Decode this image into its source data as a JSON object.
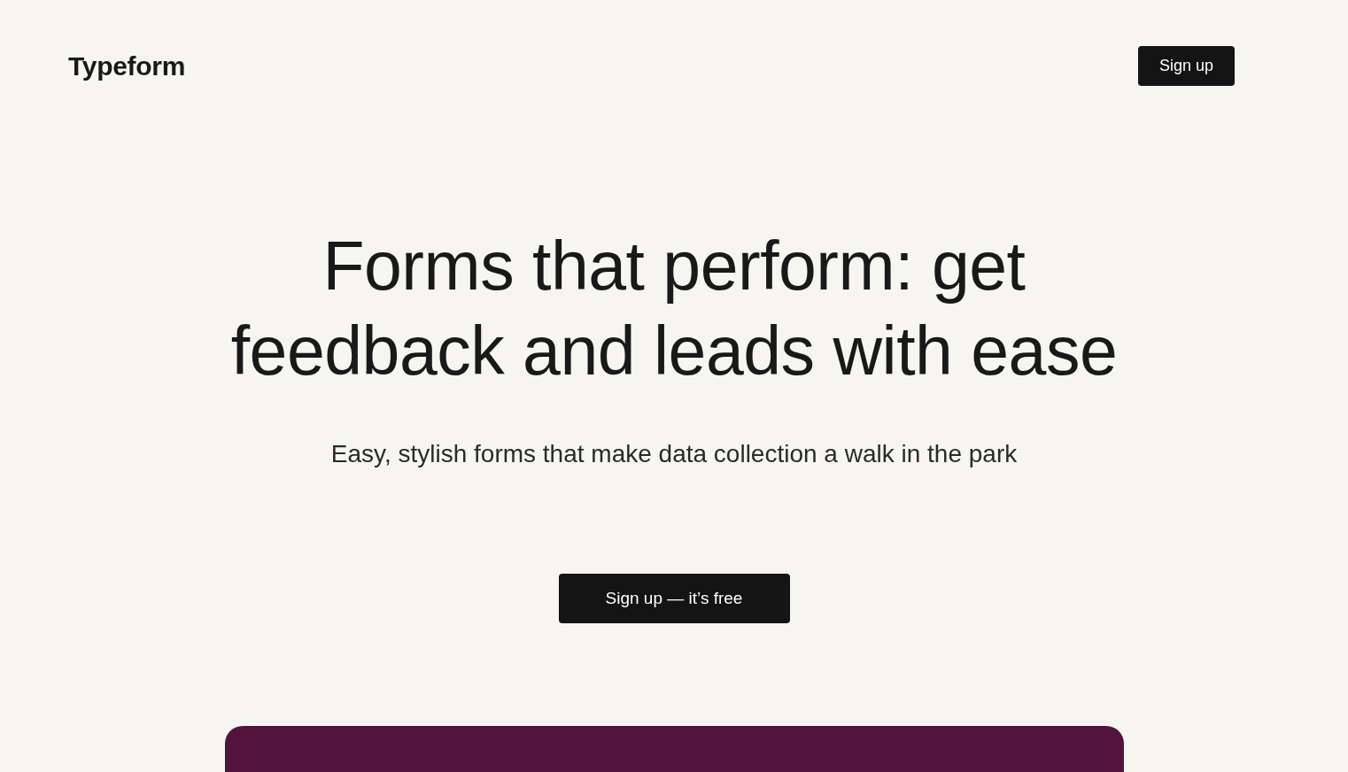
{
  "header": {
    "logo": "Typeform",
    "signup_button": "Sign up"
  },
  "hero": {
    "heading": "Forms that perform: get feedback and leads with ease",
    "subheading": "Easy, stylish forms that make data collection a walk in the park",
    "cta_button": "Sign up — it’s free"
  }
}
